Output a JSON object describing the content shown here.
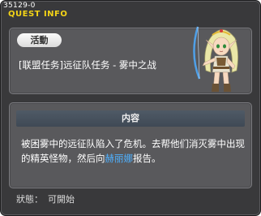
{
  "window": {
    "quest_id": "35129-0",
    "title": "QUEST INFO"
  },
  "quest": {
    "category": "活動",
    "name": "[联盟任务]远征队任务 - 雾中之战"
  },
  "content": {
    "header": "内容",
    "desc_part1": "被困雾中的远征队陷入了危机。去帮他们消灭雾中出现的精英怪物，然后向",
    "npc_name": "赫丽娜",
    "desc_part2": "报告。"
  },
  "status": {
    "label": "狀態：",
    "value": "可開始"
  },
  "colors": {
    "title": "#f4d417",
    "highlight": "#4fb1ff",
    "panel": "#59595c",
    "window": "#39393b"
  },
  "icons": {
    "portrait": "npc-archer-elf-portrait"
  }
}
